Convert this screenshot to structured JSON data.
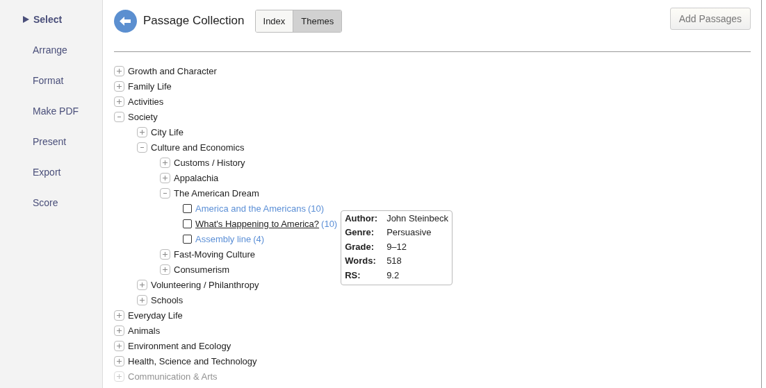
{
  "sidebar": {
    "items": [
      {
        "label": "Select",
        "selected": true
      },
      {
        "label": "Arrange",
        "selected": false
      },
      {
        "label": "Format",
        "selected": false
      },
      {
        "label": "Make PDF",
        "selected": false
      },
      {
        "label": "Present",
        "selected": false
      },
      {
        "label": "Export",
        "selected": false
      },
      {
        "label": "Score",
        "selected": false
      }
    ]
  },
  "header": {
    "title": "Passage Collection",
    "tabs": [
      {
        "label": "Index",
        "selected": false
      },
      {
        "label": "Themes",
        "selected": true
      }
    ],
    "action": "Add Passages"
  },
  "tree": [
    {
      "kind": "topic",
      "label": "Growth and Character",
      "expanded": false
    },
    {
      "kind": "topic",
      "label": "Family Life",
      "expanded": false
    },
    {
      "kind": "topic",
      "label": "Activities",
      "expanded": false
    },
    {
      "kind": "topic",
      "label": "Society",
      "expanded": true,
      "children": [
        {
          "kind": "topic",
          "label": "City Life",
          "expanded": false
        },
        {
          "kind": "topic",
          "label": "Culture and Economics",
          "expanded": true,
          "children": [
            {
              "kind": "topic",
              "label": "Customs / History",
              "expanded": false
            },
            {
              "kind": "topic",
              "label": "Appalachia",
              "expanded": false
            },
            {
              "kind": "topic",
              "label": "The American Dream",
              "expanded": true,
              "children": [
                {
                  "kind": "passage",
                  "title": "America and the Americans",
                  "count": "(10)",
                  "checked": false,
                  "hovered": false
                },
                {
                  "kind": "passage",
                  "title": "What's Happening to America?",
                  "count": "(10)",
                  "checked": false,
                  "hovered": true,
                  "tooltip": [
                    {
                      "label": "Author:",
                      "value": "John Steinbeck"
                    },
                    {
                      "label": "Genre:",
                      "value": "Persuasive"
                    },
                    {
                      "label": "Grade:",
                      "value": "9–12"
                    },
                    {
                      "label": "Words:",
                      "value": "518"
                    },
                    {
                      "label": "RS:",
                      "value": "9.2"
                    }
                  ]
                },
                {
                  "kind": "passage",
                  "title": "Assembly line",
                  "count": "(4)",
                  "checked": false,
                  "hovered": false
                }
              ]
            },
            {
              "kind": "topic",
              "label": "Fast-Moving Culture",
              "expanded": false
            },
            {
              "kind": "topic",
              "label": "Consumerism",
              "expanded": false
            }
          ]
        },
        {
          "kind": "topic",
          "label": "Volunteering / Philanthropy",
          "expanded": false
        },
        {
          "kind": "topic",
          "label": "Schools",
          "expanded": false
        }
      ]
    },
    {
      "kind": "topic",
      "label": "Everyday Life",
      "expanded": false
    },
    {
      "kind": "topic",
      "label": "Animals",
      "expanded": false
    },
    {
      "kind": "topic",
      "label": "Environment and Ecology",
      "expanded": false
    },
    {
      "kind": "topic",
      "label": "Health, Science and Technology",
      "expanded": false
    },
    {
      "kind": "topic",
      "label": "Communication & Arts",
      "expanded": false,
      "faded": true
    }
  ]
}
